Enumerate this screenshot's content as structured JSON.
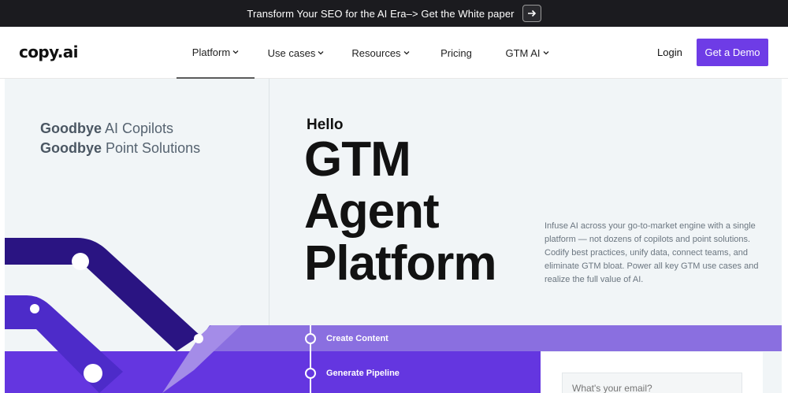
{
  "announcement": {
    "text": "Transform Your SEO for the AI Era–> Get the White paper",
    "arrow_icon": "arrow-right-icon"
  },
  "nav": {
    "logo": "copy.ai",
    "items": [
      {
        "label": "Platform",
        "has_dropdown": true,
        "active": true
      },
      {
        "label": "Use cases",
        "has_dropdown": true
      },
      {
        "label": "Resources",
        "has_dropdown": true
      },
      {
        "label": "Pricing",
        "has_dropdown": false
      },
      {
        "label": "GTM AI",
        "has_dropdown": true
      }
    ],
    "login": "Login",
    "cta": "Get a Demo"
  },
  "hero": {
    "tagline": [
      {
        "bold": "Goodbye",
        "rest": " AI Copilots"
      },
      {
        "bold": "Goodbye",
        "rest": " Point Solutions"
      }
    ],
    "hello": "Hello",
    "headline": [
      "GTM",
      "Agent",
      "Platform"
    ],
    "description": "Infuse AI across your go-to-market engine with a single platform — not dozens of copilots and point solutions. Codify best practices, unify data, connect teams, and eliminate GTM bloat. Power all key GTM use cases and realize the full value of AI.",
    "steps": [
      "Create Content",
      "Generate Pipeline"
    ],
    "email_placeholder": "What's your email?"
  },
  "colors": {
    "accent": "#6e3ce6",
    "band_light": "#8a6fe0",
    "band_dark": "#6436e0",
    "track_dark": "#2a1482",
    "track_mid": "#4d2bc9"
  }
}
